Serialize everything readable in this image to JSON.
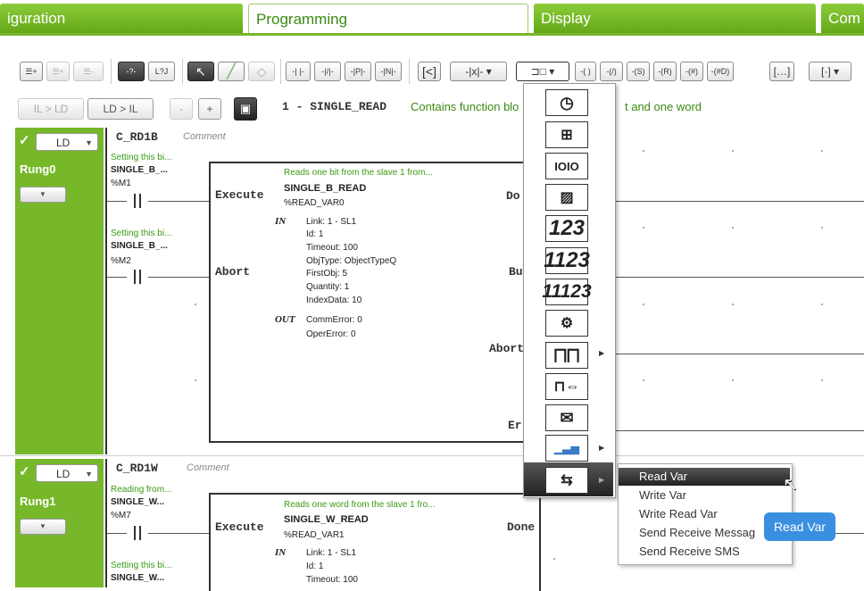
{
  "tabs": [
    {
      "label": "iguration"
    },
    {
      "label": "Programming"
    },
    {
      "label": "Display"
    },
    {
      "label": "Com"
    }
  ],
  "toolbar": {
    "il_ld": "IL > LD",
    "ld_il": "LD > IL",
    "minus": "-",
    "plus": "+",
    "dark1": "-?-",
    "l2": "L?J",
    "contacts": [
      "-| |-",
      "-|/|-",
      "-|P|-",
      "-|N|-"
    ],
    "coils": [
      "-( )",
      "-(/)",
      "-(S)",
      "-(R)",
      "-(#)",
      "-(#D)"
    ]
  },
  "program": {
    "title": "1 - SINGLE_READ",
    "description": "Contains function blo",
    "description2": "t and one word"
  },
  "rungs": [
    {
      "mode": "LD",
      "name": "Rung0",
      "title": "C_RD1B",
      "comment": "Comment",
      "contacts": [
        {
          "comment": "Setting this bi...",
          "name": "SINGLE_B_...",
          "addr": "%M1"
        },
        {
          "comment": "Setting this bi...",
          "name": "SINGLE_B_...",
          "addr": "%M2"
        }
      ],
      "block": {
        "comment": "Reads one bit from the slave 1 from...",
        "name": "SINGLE_B_READ",
        "var": "%READ_VAR0",
        "in_label": "IN",
        "inputs": [
          "Link: 1 - SL1",
          "Id: 1",
          "Timeout: 100",
          "ObjType: ObjectTypeQ",
          "FirstObj: 5",
          "Quantity: 1",
          "IndexData: 10"
        ],
        "out_label": "OUT",
        "outputs": [
          "CommError: 0",
          "OperError: 0"
        ],
        "left_pins": [
          "Execute",
          "Abort"
        ],
        "right_pins": [
          "Do",
          "Bu",
          "Abort",
          "Er"
        ]
      }
    },
    {
      "mode": "LD",
      "name": "Rung1",
      "title": "C_RD1W",
      "comment": "Comment",
      "contacts": [
        {
          "comment": "Reading from...",
          "name": "SINGLE_W...",
          "addr": "%M7"
        },
        {
          "comment": "Setting this bi...",
          "name": "SINGLE_W..."
        }
      ],
      "block": {
        "comment": "Reads one word from the slave 1 fro...",
        "name": "SINGLE_W_READ",
        "var": "%READ_VAR1",
        "in_label": "IN",
        "inputs": [
          "Link: 1 - SL1",
          "Id: 1",
          "Timeout: 100"
        ],
        "left_pins": [
          "Execute"
        ],
        "right_pins": [
          "Done"
        ]
      }
    }
  ],
  "palette": {
    "items": [
      "timer-icon",
      "counter-icon",
      "shift-register-icon",
      "step-counter-icon",
      "123",
      "1123",
      "11123",
      "drum-icon",
      "pulse-icon",
      "pulse-detect-icon",
      "message-icon",
      "schedule-icon",
      "communication-icon"
    ]
  },
  "submenu": {
    "items": [
      "Read Var",
      "Write Var",
      "Write Read Var",
      "Send Receive Messag",
      "Send Receive SMS"
    ],
    "selected": "Read Var"
  },
  "tooltip": "Read Var",
  "colors": {
    "accent": "#76b82a",
    "green_text": "#3a9a12",
    "tooltip": "#3a8fe0"
  }
}
